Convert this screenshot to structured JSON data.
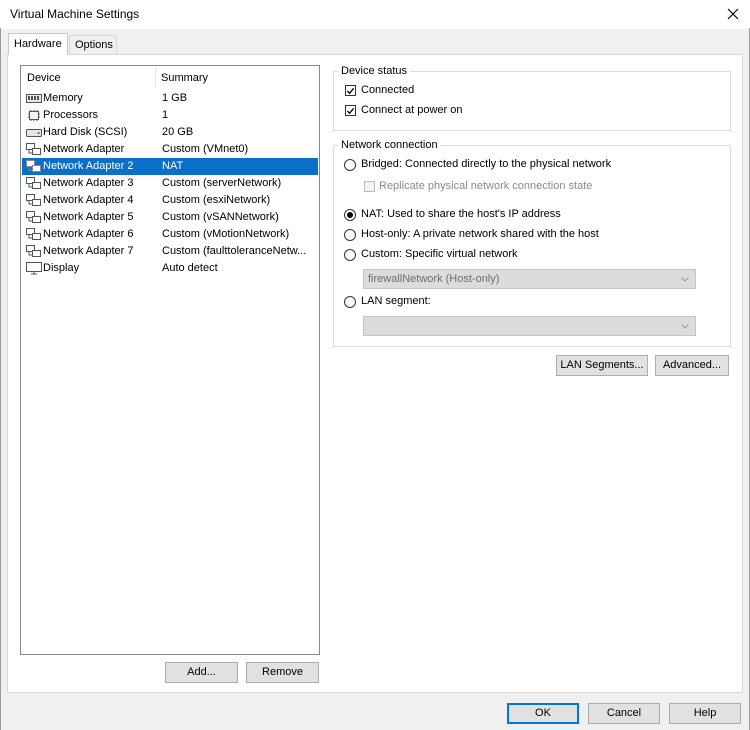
{
  "window": {
    "title": "Virtual Machine Settings"
  },
  "tabs": [
    {
      "label": "Hardware",
      "active": true
    },
    {
      "label": "Options",
      "active": false
    }
  ],
  "device_list": {
    "headers": {
      "device": "Device",
      "summary": "Summary"
    },
    "rows": [
      {
        "icon": "memory-icon",
        "device": "Memory",
        "summary": "1 GB",
        "selected": false
      },
      {
        "icon": "processor-icon",
        "device": "Processors",
        "summary": "1",
        "selected": false
      },
      {
        "icon": "hard-disk-icon",
        "device": "Hard Disk (SCSI)",
        "summary": "20 GB",
        "selected": false
      },
      {
        "icon": "network-adapter-icon",
        "device": "Network Adapter",
        "summary": "Custom (VMnet0)",
        "selected": false
      },
      {
        "icon": "network-adapter-icon",
        "device": "Network Adapter 2",
        "summary": "NAT",
        "selected": true
      },
      {
        "icon": "network-adapter-icon",
        "device": "Network Adapter 3",
        "summary": "Custom (serverNetwork)",
        "selected": false
      },
      {
        "icon": "network-adapter-icon",
        "device": "Network Adapter 4",
        "summary": "Custom (esxiNetwork)",
        "selected": false
      },
      {
        "icon": "network-adapter-icon",
        "device": "Network Adapter 5",
        "summary": "Custom (vSANNetwork)",
        "selected": false
      },
      {
        "icon": "network-adapter-icon",
        "device": "Network Adapter 6",
        "summary": "Custom (vMotionNetwork)",
        "selected": false
      },
      {
        "icon": "network-adapter-icon",
        "device": "Network Adapter 7",
        "summary": "Custom (faulttoleranceNetw...",
        "selected": false
      },
      {
        "icon": "display-icon",
        "device": "Display",
        "summary": "Auto detect",
        "selected": false
      }
    ]
  },
  "device_status": {
    "group_label": "Device status",
    "connected": {
      "label": "Connected",
      "checked": true
    },
    "connect_at_power_on": {
      "label": "Connect at power on",
      "checked": true
    }
  },
  "network_connection": {
    "group_label": "Network connection",
    "bridged": {
      "label": "Bridged: Connected directly to the physical network",
      "selected": false
    },
    "replicate": {
      "label": "Replicate physical network connection state",
      "checked": false,
      "enabled": false
    },
    "nat": {
      "label": "NAT: Used to share the host's IP address",
      "selected": true
    },
    "host_only": {
      "label": "Host-only: A private network shared with the host",
      "selected": false
    },
    "custom": {
      "label": "Custom: Specific virtual network",
      "selected": false
    },
    "custom_select_value": "firewallNetwork (Host-only)",
    "lan_segment": {
      "label": "LAN segment:",
      "selected": false
    },
    "lan_segment_select_value": ""
  },
  "buttons": {
    "lan_segments": "LAN Segments...",
    "advanced": "Advanced...",
    "add": "Add...",
    "remove": "Remove",
    "ok": "OK",
    "cancel": "Cancel",
    "help": "Help"
  },
  "colors": {
    "selection": "#0a6fc8",
    "default_button_border": "#0078d7"
  }
}
